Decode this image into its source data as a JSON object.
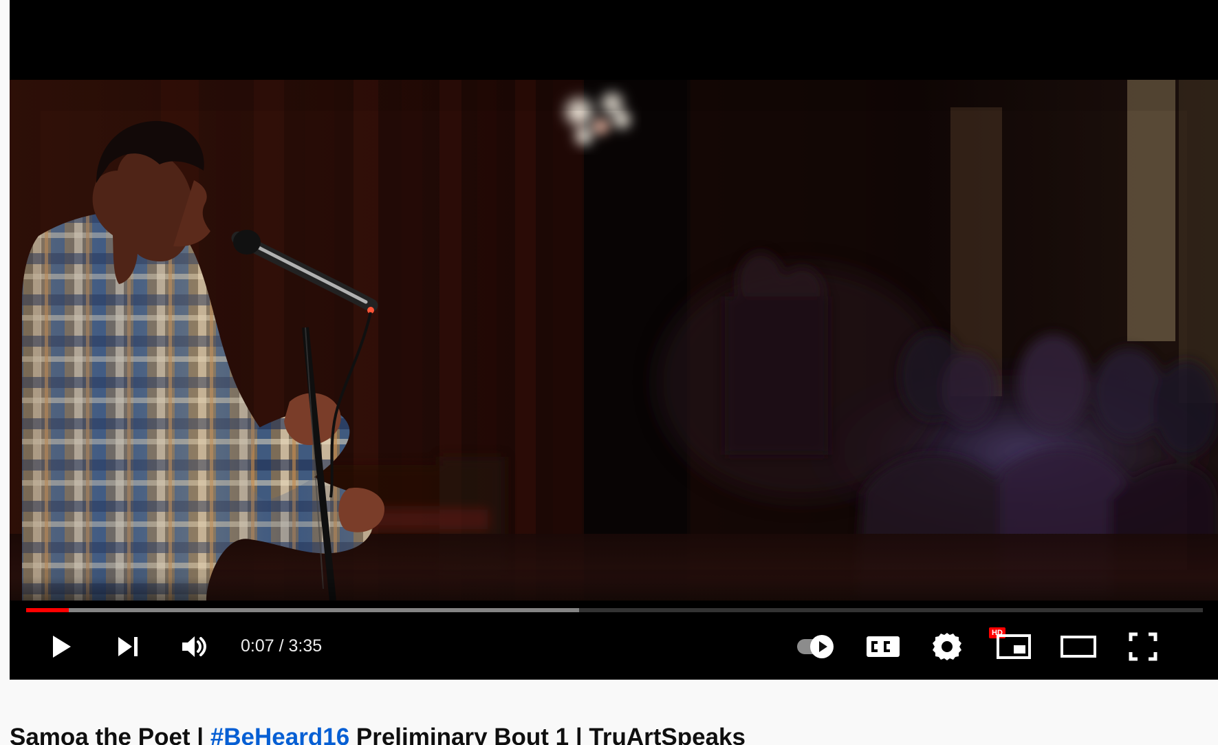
{
  "player": {
    "time": {
      "current": "0:07",
      "separator": "/",
      "duration": "3:35",
      "display": "0:07 / 3:35"
    },
    "progress": {
      "played_fraction": 0.036,
      "loaded_fraction": 0.47
    },
    "settings": {
      "quality_badge": "HD"
    },
    "icons": {
      "play": "play-icon",
      "next": "next-icon",
      "volume": "volume-icon",
      "autoplay": "autoplay-toggle-icon",
      "captions": "captions-icon",
      "settings": "gear-icon",
      "miniplayer": "miniplayer-icon",
      "theater": "theater-mode-icon",
      "fullscreen": "fullscreen-icon"
    }
  },
  "video": {
    "title_prefix": "Samoa the Poet | ",
    "hashtag": "#BeHeard16",
    "title_suffix": " Preliminary Bout 1 | TruArtSpeaks"
  },
  "colors": {
    "progress_played": "#ff0000",
    "hashtag_link": "#065fd4",
    "title_text": "#0f0f0f",
    "player_background": "#000000"
  }
}
